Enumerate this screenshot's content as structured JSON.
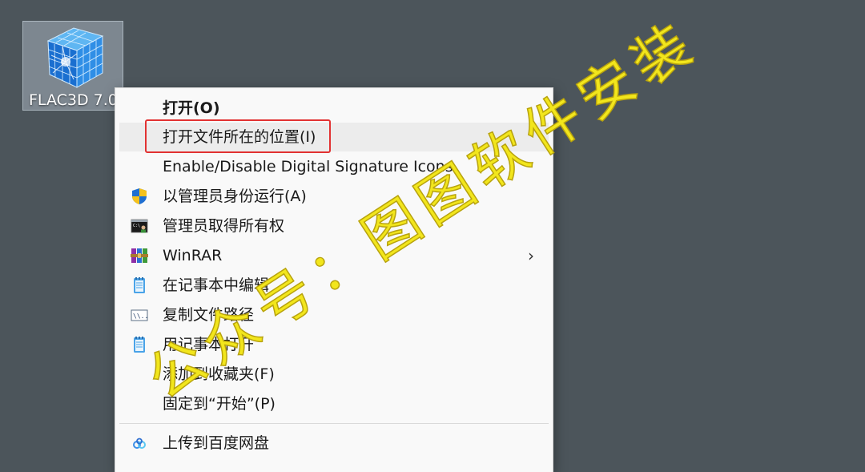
{
  "desktop": {
    "icon_label": "FLAC3D 7.0",
    "icon_name": "flac3d-cube-icon"
  },
  "menu": {
    "items": [
      {
        "label": "打开(O)",
        "icon": null
      },
      {
        "label": "打开文件所在的位置(I)",
        "icon": null
      },
      {
        "label": "Enable/Disable Digital Signature Icons",
        "icon": null
      },
      {
        "label": "以管理员身份运行(A)",
        "icon": "uac-shield-icon"
      },
      {
        "label": "管理员取得所有权",
        "icon": "cmd-admin-icon"
      },
      {
        "label": "WinRAR",
        "icon": "winrar-books-icon",
        "submenu": true
      },
      {
        "label": "在记事本中编辑",
        "icon": "notepad-icon"
      },
      {
        "label": "复制文件路径",
        "icon": "copy-path-icon"
      },
      {
        "label": "用记事本打开",
        "icon": "notepad-icon"
      },
      {
        "label": "添加到收藏夹(F)",
        "icon": null
      },
      {
        "label": "固定到“开始”(P)",
        "icon": null
      },
      {
        "label": "上传到百度网盘",
        "icon": "baidu-netdisk-icon"
      }
    ],
    "submenu_arrow": "›",
    "highlight_color": "#e23232"
  },
  "watermark": {
    "text": "公众号：图图软件安装",
    "color": "#f2e61c"
  }
}
